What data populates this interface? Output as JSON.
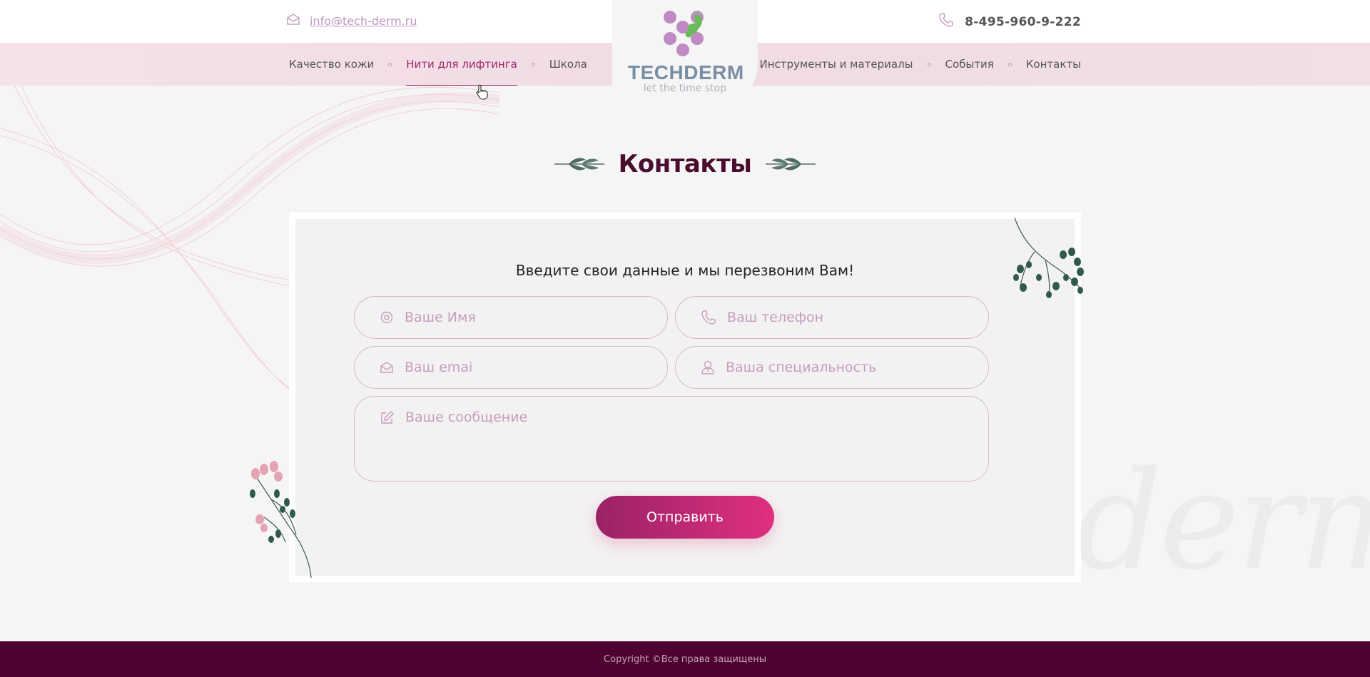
{
  "header": {
    "email": "info@tech-derm.ru",
    "phone": "8-495-960-9-222",
    "logo_name": "TECHDERM",
    "logo_tagline": "let the time stop"
  },
  "nav": {
    "left": [
      {
        "label": "Качество кожи",
        "active": false
      },
      {
        "label": "Нити для лифтинга",
        "active": true
      },
      {
        "label": "Школа",
        "active": false
      }
    ],
    "right": [
      {
        "label": "Инструменты и материалы"
      },
      {
        "label": "События"
      },
      {
        "label": "Контакты"
      }
    ]
  },
  "page": {
    "title": "Контакты"
  },
  "form": {
    "title": "Введите свои данные и мы перезвоним Вам!",
    "name_placeholder": "Ваше Имя",
    "phone_placeholder": "Ваш телефон",
    "email_placeholder": "Ваш emai",
    "specialty_placeholder": "Ваша специальность",
    "message_placeholder": "Ваше сообщение",
    "submit_label": "Отправить"
  },
  "decor": {
    "watermark": "Techderm"
  },
  "footer": {
    "copyright": "Copyright ©Все права защищены"
  },
  "colors": {
    "accent": "#a3246a",
    "button_start": "#9a2266",
    "button_end": "#e0307f",
    "footer_bg": "#4d0230",
    "heading": "#4a0d2e",
    "placeholder": "#c79dbd"
  }
}
